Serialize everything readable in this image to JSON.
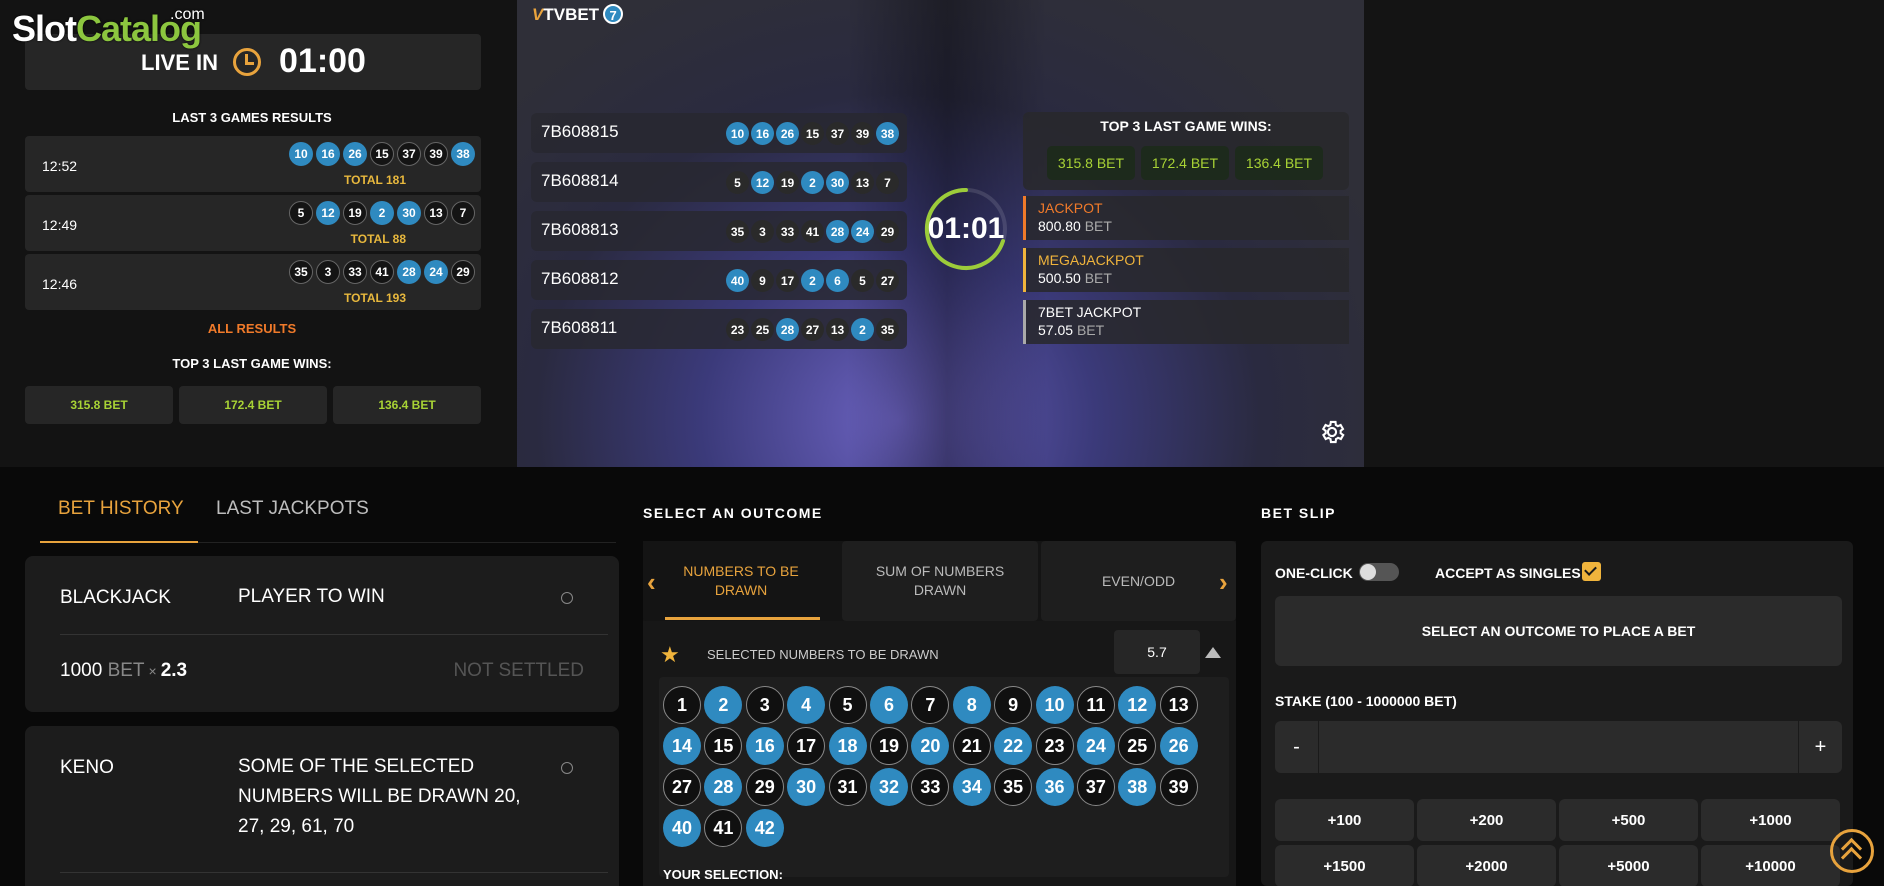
{
  "logo": {
    "slot": "Slot",
    "catalog": "Catalog",
    "com": ".com"
  },
  "live": {
    "label": "LIVE IN",
    "time": "01:00"
  },
  "left": {
    "last_title": "LAST 3 GAMES RESULTS",
    "results": [
      {
        "time": "12:52",
        "balls": [
          "10",
          "16",
          "26",
          "15",
          "37",
          "39",
          "38"
        ],
        "blue": [
          1,
          1,
          1,
          0,
          0,
          0,
          1
        ],
        "total": "TOTAL 181"
      },
      {
        "time": "12:49",
        "balls": [
          "5",
          "12",
          "19",
          "2",
          "30",
          "13",
          "7"
        ],
        "blue": [
          0,
          1,
          0,
          1,
          1,
          0,
          0
        ],
        "total": "TOTAL 88"
      },
      {
        "time": "12:46",
        "balls": [
          "35",
          "3",
          "33",
          "41",
          "28",
          "24",
          "29"
        ],
        "blue": [
          0,
          0,
          0,
          0,
          1,
          1,
          0
        ],
        "total": "TOTAL 193"
      }
    ],
    "all_results": "ALL RESULTS",
    "wins_title": "TOP 3 LAST GAME WINS:",
    "wins": [
      "315.8 BET",
      "172.4 BET",
      "136.4 BET"
    ]
  },
  "video": {
    "brand": "TVBET",
    "brand_num": "7",
    "draws": [
      {
        "id": "7B608815",
        "balls": [
          "10",
          "16",
          "26",
          "15",
          "37",
          "39",
          "38"
        ],
        "blue": [
          1,
          1,
          1,
          0,
          0,
          0,
          1
        ]
      },
      {
        "id": "7B608814",
        "balls": [
          "5",
          "12",
          "19",
          "2",
          "30",
          "13",
          "7"
        ],
        "blue": [
          0,
          1,
          0,
          1,
          1,
          0,
          0
        ]
      },
      {
        "id": "7B608813",
        "balls": [
          "35",
          "3",
          "33",
          "41",
          "28",
          "24",
          "29"
        ],
        "blue": [
          0,
          0,
          0,
          0,
          1,
          1,
          0
        ]
      },
      {
        "id": "7B608812",
        "balls": [
          "40",
          "9",
          "17",
          "2",
          "6",
          "5",
          "27"
        ],
        "blue": [
          1,
          0,
          0,
          1,
          1,
          0,
          0
        ]
      },
      {
        "id": "7B608811",
        "balls": [
          "23",
          "25",
          "28",
          "27",
          "13",
          "2",
          "35"
        ],
        "blue": [
          0,
          0,
          1,
          0,
          0,
          1,
          0
        ]
      }
    ],
    "countdown": "01:01",
    "top_title": "TOP 3 LAST GAME WINS:",
    "top_wins": [
      "315.8 BET",
      "172.4 BET",
      "136.4 BET"
    ],
    "jackpots": [
      {
        "name": "JACKPOT",
        "value": "800.80",
        "unit": "BET",
        "color": "#f07a2a"
      },
      {
        "name": "MEGAJACKPOT",
        "value": "500.50",
        "unit": "BET",
        "color": "#f0b43c"
      },
      {
        "name": "7BET JACKPOT",
        "value": "57.05",
        "unit": "BET",
        "color": "#ffffff"
      }
    ]
  },
  "history": {
    "tab_active": "BET HISTORY",
    "tab_inactive": "LAST JACKPOTS",
    "card1": {
      "game": "BLACKJACK",
      "desc": "PLAYER TO WIN",
      "amount": "1000",
      "unit": "BET",
      "times": "×",
      "mult": "2.3",
      "status": "NOT SETTLED"
    },
    "card2": {
      "game": "KENO",
      "desc": "SOME OF THE SELECTED NUMBERS WILL BE DRAWN 20, 27, 29, 61, 70"
    }
  },
  "outcome": {
    "title": "SELECT AN OUTCOME",
    "tabs": [
      "NUMBERS TO BE DRAWN",
      "SUM OF NUMBERS DRAWN",
      "EVEN/ODD"
    ],
    "selected_label": "SELECTED NUMBERS TO BE DRAWN",
    "odd": "5.7",
    "numbers": [
      "1",
      "2",
      "3",
      "4",
      "5",
      "6",
      "7",
      "8",
      "9",
      "10",
      "11",
      "12",
      "13",
      "14",
      "15",
      "16",
      "17",
      "18",
      "19",
      "20",
      "21",
      "22",
      "23",
      "24",
      "25",
      "26",
      "27",
      "28",
      "29",
      "30",
      "31",
      "32",
      "33",
      "34",
      "35",
      "36",
      "37",
      "38",
      "39",
      "40",
      "41",
      "42"
    ],
    "blue": [
      0,
      1,
      0,
      1,
      0,
      1,
      0,
      1,
      0,
      1,
      0,
      1,
      0,
      1,
      0,
      1,
      0,
      1,
      0,
      1,
      0,
      1,
      0,
      1,
      0,
      1,
      0,
      1,
      0,
      1,
      0,
      1,
      0,
      1,
      0,
      1,
      0,
      1,
      0,
      1,
      0,
      1
    ],
    "your_selection": "YOUR SELECTION:"
  },
  "slip": {
    "title": "BET SLIP",
    "one_click": "ONE-CLICK",
    "accept": "ACCEPT AS SINGLES",
    "place": "SELECT AN OUTCOME TO PLACE A BET",
    "stake_label": "STAKE (100 - 1000000 BET)",
    "minus": "-",
    "plus": "+",
    "quick": [
      "+100",
      "+200",
      "+500",
      "+1000",
      "+1500",
      "+2000",
      "+5000",
      "+10000"
    ]
  },
  "colors": {
    "accent": "#e8a33d",
    "ball_blue": "#2f8ac0",
    "win_green": "#a8d335"
  }
}
